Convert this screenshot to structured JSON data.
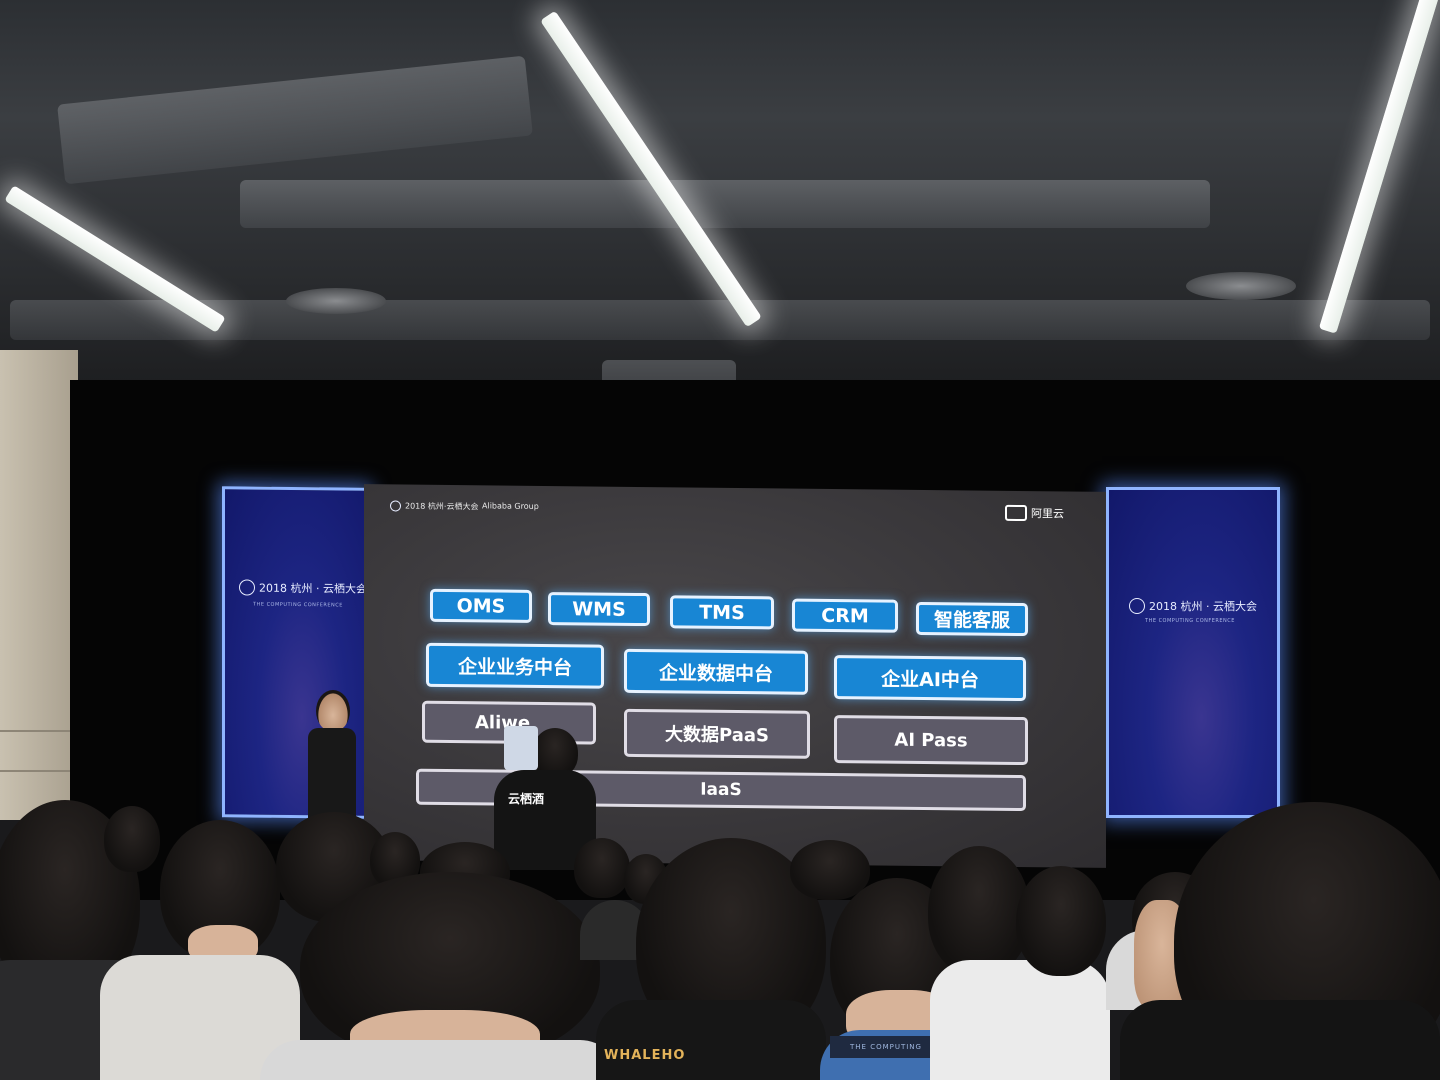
{
  "screen": {
    "header_left": "2018 杭州·云栖大会",
    "header_middle": "Alibaba Group",
    "header_right": "阿里云",
    "row1": [
      "OMS",
      "WMS",
      "TMS",
      "CRM",
      "智能客服"
    ],
    "row2": [
      "企业业务中台",
      "企业数据中台",
      "企业AI中台"
    ],
    "row3": [
      "Aliwe",
      "大数据PaaS",
      "AI Pass"
    ],
    "row4": "IaaS"
  },
  "side_panels": {
    "left_title": "2018 杭州 · 云栖大会",
    "right_title": "2018 杭州 · 云栖大会",
    "subtitle": "THE COMPUTING CONFERENCE"
  },
  "crew_shirt": "云栖酒",
  "attendee_shirt": "WHALEHO",
  "attendee_badge": "THE COMPUTING",
  "colors": {
    "chip_blue": "#1886d4",
    "chip_grey": "#5d5a68",
    "side_panel": "#1d2583",
    "screen_bg": "#3b393c"
  }
}
